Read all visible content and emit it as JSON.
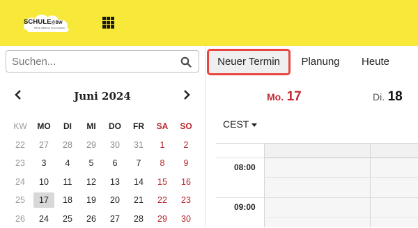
{
  "header": {
    "logo_text": "SCHULE",
    "logo_suffix": "@BW",
    "logo_subtitle": "Schule | Bildung | Kommunikation",
    "apps_icon": "apps-grid-icon",
    "background_color": "#f7e83a"
  },
  "search": {
    "placeholder": "Suchen...",
    "value": "",
    "icon": "search-icon"
  },
  "toolbar": {
    "new_appointment": "Neuer Termin",
    "planning": "Planung",
    "today": "Heute",
    "highlight_color": "#e8463f"
  },
  "mini_calendar": {
    "title": "Juni 2024",
    "prev_icon": "chevron-left-icon",
    "next_icon": "chevron-right-icon",
    "headers": [
      "KW",
      "MO",
      "DI",
      "MI",
      "DO",
      "FR",
      "SA",
      "SO"
    ],
    "weeks": [
      [
        "22",
        "27",
        "28",
        "29",
        "30",
        "31",
        "1",
        "2"
      ],
      [
        "23",
        "3",
        "4",
        "5",
        "6",
        "7",
        "8",
        "9"
      ],
      [
        "24",
        "10",
        "11",
        "12",
        "13",
        "14",
        "15",
        "16"
      ],
      [
        "25",
        "17",
        "18",
        "19",
        "20",
        "21",
        "22",
        "23"
      ],
      [
        "26",
        "24",
        "25",
        "26",
        "27",
        "28",
        "29",
        "30"
      ]
    ],
    "selected_day": "17",
    "weekend_color": "#b3262d"
  },
  "day_view": {
    "days": [
      {
        "name": "Mo.",
        "number": "17",
        "is_today": true
      },
      {
        "name": "Di.",
        "number": "18",
        "is_today": false
      }
    ],
    "timezone": "CEST",
    "hours": [
      "08:00",
      "09:00"
    ],
    "today_color": "#c3272f"
  }
}
